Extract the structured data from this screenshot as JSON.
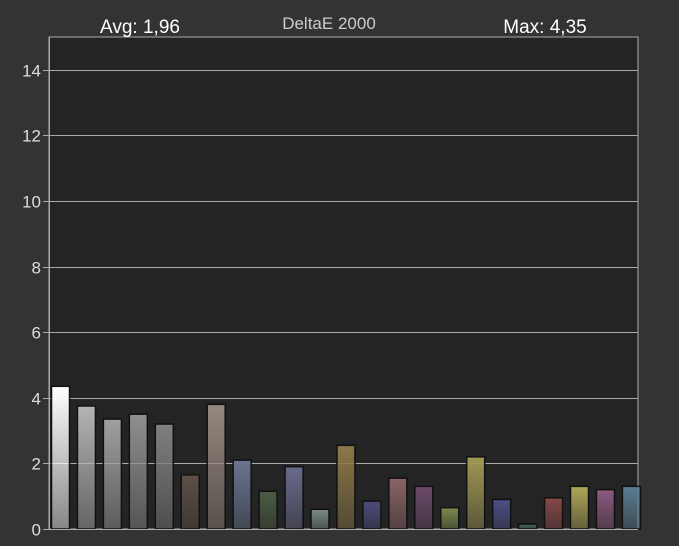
{
  "header": {
    "avg_text": "Avg: 1,96",
    "title": "DeltaE 2000",
    "max_text": "Max: 4,35"
  },
  "colors": {
    "background": "#333333",
    "plot_bg": "#242424",
    "grid": "#aaaaaa",
    "axis_text": "#dddddd",
    "title_text": "#cccccc",
    "header_text": "#ffffff"
  },
  "chart_data": {
    "type": "bar",
    "title": "DeltaE 2000",
    "xlabel": "",
    "ylabel": "",
    "ylim": [
      0,
      15
    ],
    "y_ticks": [
      0,
      2,
      4,
      6,
      8,
      10,
      12,
      14
    ],
    "y_tick_labels": [
      "0",
      "2",
      "4",
      "6",
      "8",
      "10",
      "12",
      "14"
    ],
    "grid": true,
    "values": [
      4.35,
      3.75,
      3.35,
      3.5,
      3.2,
      1.65,
      3.8,
      2.1,
      1.15,
      1.9,
      0.6,
      2.55,
      0.85,
      1.55,
      1.3,
      0.65,
      2.2,
      0.9,
      0.15,
      0.95,
      1.3,
      1.2,
      1.3
    ],
    "bar_colors": [
      "#ffffff",
      "#b4b4b4",
      "#a0a0a0",
      "#909090",
      "#808080",
      "#5e5048",
      "#96887e",
      "#6a7490",
      "#4c5c44",
      "#6a6a8c",
      "#7a8c8a",
      "#8c7848",
      "#4c4c7c",
      "#8a6468",
      "#6a4a6a",
      "#7a8a4c",
      "#a09854",
      "#4c5088",
      "#4a6a56",
      "#884848",
      "#b0a858",
      "#8c5a80",
      "#5a7e92"
    ]
  }
}
